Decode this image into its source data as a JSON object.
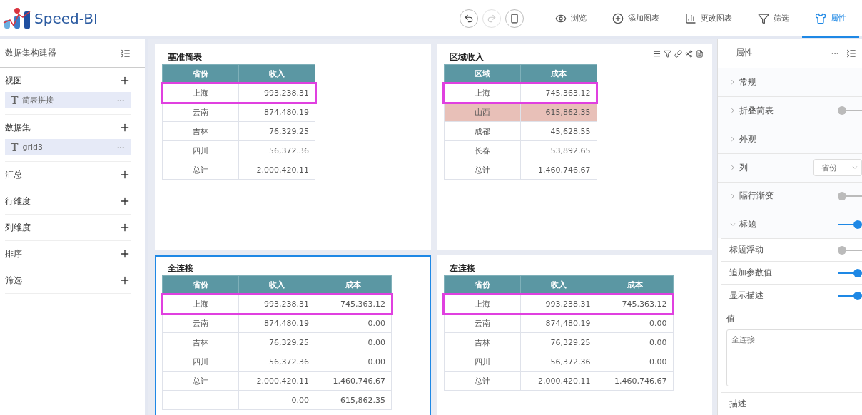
{
  "app": {
    "name": "Speed-BI"
  },
  "toolbar": {
    "round_buttons": [
      {
        "kind": "undo",
        "disabled": false
      },
      {
        "kind": "redo",
        "disabled": true
      },
      {
        "kind": "mobile",
        "disabled": false
      }
    ],
    "items": [
      {
        "kind": "eye",
        "label": "浏览",
        "selected": false
      },
      {
        "kind": "plus",
        "label": "添加图表",
        "selected": false
      },
      {
        "kind": "bars",
        "label": "更改图表",
        "selected": false
      },
      {
        "kind": "filter",
        "label": "筛选",
        "selected": false
      },
      {
        "kind": "shirt",
        "label": "属性",
        "selected": true
      }
    ]
  },
  "sidebar": {
    "title": "数据集构建器",
    "sections": [
      {
        "label": "视图",
        "items": [
          {
            "type_glyph": "T",
            "label": "简表拼接"
          }
        ]
      },
      {
        "label": "数据集",
        "items": [
          {
            "type_glyph": "T",
            "label": "grid3"
          }
        ]
      },
      {
        "label": "汇总"
      },
      {
        "label": "行维度"
      },
      {
        "label": "列维度"
      },
      {
        "label": "排序"
      },
      {
        "label": "筛选"
      }
    ]
  },
  "panels": [
    {
      "title": "基准简表",
      "selected": false,
      "toolbar": false,
      "columns": [
        "省份",
        "收入"
      ],
      "rows": [
        {
          "cells": [
            "上海",
            "993,238.31"
          ],
          "marked": true,
          "tinted": false
        },
        {
          "cells": [
            "云南",
            "874,480.19"
          ],
          "marked": false,
          "tinted": false
        },
        {
          "cells": [
            "吉林",
            "76,329.25"
          ],
          "marked": false,
          "tinted": false
        },
        {
          "cells": [
            "四川",
            "56,372.36"
          ],
          "marked": false,
          "tinted": false
        },
        {
          "cells": [
            "总计",
            "2,000,420.11"
          ],
          "marked": false,
          "tinted": false
        }
      ]
    },
    {
      "title": "区域收入",
      "selected": false,
      "toolbar": true,
      "columns": [
        "区域",
        "成本"
      ],
      "rows": [
        {
          "cells": [
            "上海",
            "745,363.12"
          ],
          "marked": true,
          "tinted": false
        },
        {
          "cells": [
            "山西",
            "615,862.35"
          ],
          "marked": false,
          "tinted": true
        },
        {
          "cells": [
            "成都",
            "45,628.55"
          ],
          "marked": false,
          "tinted": false
        },
        {
          "cells": [
            "长春",
            "53,892.65"
          ],
          "marked": false,
          "tinted": false
        },
        {
          "cells": [
            "总计",
            "1,460,746.67"
          ],
          "marked": false,
          "tinted": false
        }
      ]
    },
    {
      "title": "全连接",
      "selected": true,
      "toolbar": false,
      "columns": [
        "省份",
        "收入",
        "成本"
      ],
      "rows": [
        {
          "cells": [
            "上海",
            "993,238.31",
            "745,363.12"
          ],
          "marked": true,
          "tinted": false
        },
        {
          "cells": [
            "云南",
            "874,480.19",
            "0.00"
          ],
          "marked": false,
          "tinted": false
        },
        {
          "cells": [
            "吉林",
            "76,329.25",
            "0.00"
          ],
          "marked": false,
          "tinted": false
        },
        {
          "cells": [
            "四川",
            "56,372.36",
            "0.00"
          ],
          "marked": false,
          "tinted": false
        },
        {
          "cells": [
            "总计",
            "2,000,420.11",
            "1,460,746.67"
          ],
          "marked": false,
          "tinted": false
        },
        {
          "cells": [
            "",
            "0.00",
            "615,862.35"
          ],
          "marked": false,
          "tinted": false
        }
      ]
    },
    {
      "title": "左连接",
      "selected": false,
      "toolbar": false,
      "columns": [
        "省份",
        "收入",
        "成本"
      ],
      "rows": [
        {
          "cells": [
            "上海",
            "993,238.31",
            "745,363.12"
          ],
          "marked": true,
          "tinted": false
        },
        {
          "cells": [
            "云南",
            "874,480.19",
            "0.00"
          ],
          "marked": false,
          "tinted": false
        },
        {
          "cells": [
            "吉林",
            "76,329.25",
            "0.00"
          ],
          "marked": false,
          "tinted": false
        },
        {
          "cells": [
            "四川",
            "56,372.36",
            "0.00"
          ],
          "marked": false,
          "tinted": false
        },
        {
          "cells": [
            "总计",
            "2,000,420.11",
            "1,460,746.67"
          ],
          "marked": false,
          "tinted": false
        }
      ]
    }
  ],
  "properties": {
    "title": "属性",
    "items": [
      {
        "kind": "group",
        "label": "常规",
        "expanded": false
      },
      {
        "kind": "group",
        "label": "折叠简表",
        "expanded": false,
        "on": false
      },
      {
        "kind": "group",
        "label": "外观",
        "expanded": false
      },
      {
        "kind": "group",
        "label": "列",
        "expanded": false,
        "select": "省份"
      },
      {
        "kind": "group",
        "label": "隔行渐变",
        "expanded": false,
        "on": false
      },
      {
        "kind": "group",
        "label": "标题",
        "expanded": true,
        "on": true
      },
      {
        "kind": "switch",
        "label": "标题浮动",
        "on": false
      },
      {
        "kind": "switch",
        "label": "追加参数值",
        "on": true
      },
      {
        "kind": "switch",
        "label": "显示描述",
        "on": true
      },
      {
        "kind": "textarea",
        "label": "值",
        "value": "全连接"
      },
      {
        "kind": "label",
        "label": "描述"
      }
    ]
  }
}
